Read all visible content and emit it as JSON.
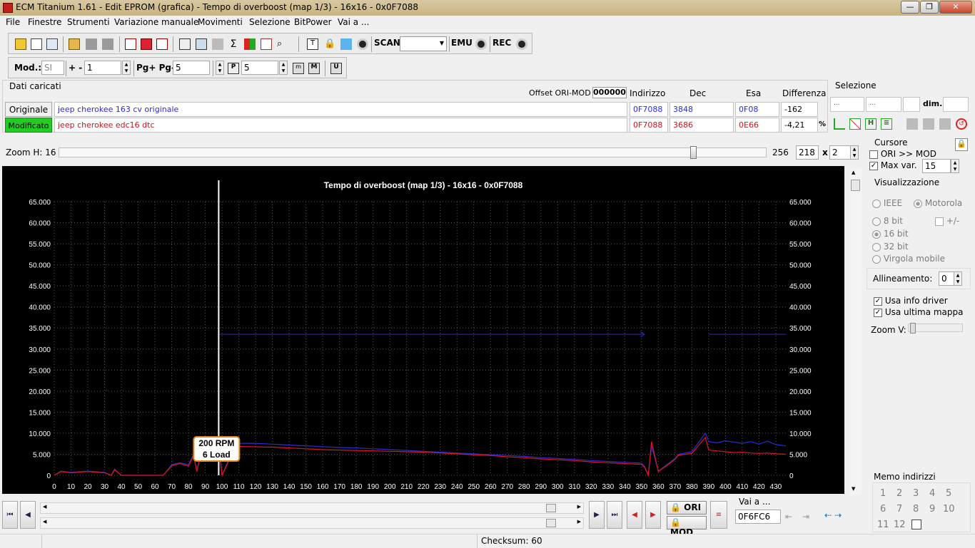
{
  "window": {
    "title": "ECM Titanium 1.61 - Edit EPROM (grafica) - Tempo di overboost (map 1/3) - 16x16 - 0x0F7088"
  },
  "menu": [
    "File",
    "Finestre",
    "Strumenti",
    "Variazione manuale",
    "Movimenti",
    "Selezione",
    "BitPower",
    "Vai a ..."
  ],
  "toolbar": {
    "scan_label": "SCAN",
    "emu_label": "EMU",
    "rec_label": "REC"
  },
  "toolbar2": {
    "mod_label": "Mod.:",
    "mod_value": "SI",
    "plusminus_label": "+ -",
    "plusminus_value": "1",
    "pg_label": "Pg+ Pg-",
    "pg_value": "5",
    "p_value": "5"
  },
  "dati": {
    "header": "Dati caricati",
    "offset_label": "Offset ORI-MOD",
    "offset_value": "000000",
    "col_indirizzo": "Indirizzo",
    "col_dec": "Dec",
    "col_esa": "Esa",
    "col_diff": "Differenza",
    "originale_label": "Originale",
    "originale_name": "jeep cherokee 163 cv originale",
    "originale_addr": "0F7088",
    "originale_dec": "3848",
    "originale_esa": "0F08",
    "originale_diff": "-162",
    "modificato_label": "Modificato",
    "modificato_name": "jeep cherokee edc16 dtc",
    "modificato_addr": "0F7088",
    "modificato_dec": "3686",
    "modificato_esa": "0E66",
    "modificato_diff": "-4,21",
    "percent": "%"
  },
  "selezione": {
    "label": "Selezione",
    "f1": "...",
    "f2": "...",
    "dim_label": "dim."
  },
  "zoom": {
    "label": "Zoom H: 16",
    "max": "256",
    "w": "218",
    "x_label": "x",
    "h": "2",
    "level": 0.9
  },
  "cursore": {
    "label": "Cursore",
    "ori_mod": "ORI >> MOD",
    "max_var_label": "Max var.",
    "max_var_value": "15"
  },
  "visual": {
    "label": "Visualizzazione",
    "ieee": "IEEE",
    "motorola": "Motorola",
    "b8": "8 bit",
    "pm": "+/-",
    "b16": "16 bit",
    "b32": "32 bit",
    "virgola": "Virgola mobile",
    "allineamento_label": "Allineamento:",
    "allineamento_value": "0",
    "usa_info": "Usa info driver",
    "usa_ultima": "Usa ultima mappa",
    "zoomv_label": "Zoom V:"
  },
  "memo": {
    "label": "Memo indirizzi",
    "slots": [
      "1",
      "2",
      "3",
      "4",
      "5",
      "6",
      "7",
      "8",
      "9",
      "10",
      "11",
      "12"
    ]
  },
  "bottom": {
    "vai_a_label": "Vai a ...",
    "vai_a_value": "0F6FC6",
    "ori_btn": "ORI",
    "mod_btn": "MOD"
  },
  "status": {
    "checksum": "Checksum: 60"
  },
  "colors": {
    "ori": "#2b2bd6",
    "mod": "#e0141e",
    "chart_bg": "#000000",
    "modificato_bg": "#22cc22"
  },
  "chart_data": {
    "type": "line",
    "title": "Tempo di overboost (map 1/3) - 16x16 - 0x0F7088",
    "xlabel": "",
    "ylabel": "",
    "xlim": [
      0,
      436
    ],
    "ylim": [
      0,
      65000
    ],
    "x_ticks": [
      0,
      10,
      20,
      30,
      40,
      50,
      60,
      70,
      80,
      90,
      100,
      110,
      120,
      130,
      140,
      150,
      160,
      170,
      180,
      190,
      200,
      210,
      220,
      230,
      240,
      250,
      260,
      270,
      280,
      290,
      300,
      310,
      320,
      330,
      340,
      350,
      360,
      370,
      380,
      390,
      400,
      410,
      420,
      430
    ],
    "y_ticks": [
      "0",
      "5.000",
      "10.000",
      "15.000",
      "20.000",
      "25.000",
      "30.000",
      "35.000",
      "40.000",
      "45.000",
      "50.000",
      "55.000",
      "60.000",
      "65.000"
    ],
    "y_tick_values": [
      0,
      5000,
      10000,
      15000,
      20000,
      25000,
      30000,
      35000,
      40000,
      45000,
      50000,
      55000,
      60000,
      65000
    ],
    "grid": true,
    "cursor_x": 98,
    "cursor_label": [
      "200 RPM",
      "6 Load"
    ],
    "series": [
      {
        "name": "ORI",
        "color": "#2b2bd6",
        "x": [
          0,
          4,
          10,
          20,
          30,
          34,
          36,
          40,
          50,
          60,
          65,
          70,
          75,
          80,
          83,
          85,
          88,
          92,
          98,
          100,
          108,
          115,
          120,
          125,
          130,
          135,
          140,
          145,
          150,
          155,
          160,
          170,
          180,
          190,
          200,
          210,
          220,
          230,
          240,
          250,
          260,
          270,
          280,
          290,
          300,
          310,
          320,
          330,
          340,
          350,
          352,
          354,
          356,
          360,
          365,
          370,
          372,
          380,
          388,
          390,
          395,
          400,
          405,
          410,
          415,
          420,
          425,
          430,
          436
        ],
        "y": [
          0,
          1000,
          700,
          1000,
          700,
          0,
          1500,
          0,
          0,
          0,
          0,
          2500,
          3000,
          2500,
          5000,
          1000,
          7000,
          7600,
          7200,
          0,
          7600,
          7600,
          7600,
          7500,
          7400,
          7300,
          7200,
          7100,
          7000,
          6900,
          6800,
          6600,
          6500,
          6300,
          6100,
          5900,
          5700,
          5500,
          5300,
          5100,
          4900,
          4700,
          4500,
          4200,
          4000,
          3800,
          3500,
          3300,
          3100,
          2900,
          2000,
          0,
          7000,
          1000,
          2500,
          4000,
          5000,
          5600,
          10000,
          8000,
          7700,
          8200,
          7900,
          7600,
          8000,
          7400,
          8100,
          7300,
          7000
        ]
      },
      {
        "name": "MOD",
        "color": "#e0141e",
        "x": [
          0,
          4,
          10,
          20,
          30,
          34,
          36,
          40,
          50,
          60,
          65,
          70,
          75,
          80,
          83,
          85,
          88,
          92,
          98,
          100,
          108,
          115,
          120,
          125,
          130,
          135,
          140,
          145,
          150,
          155,
          160,
          170,
          180,
          190,
          200,
          210,
          220,
          230,
          240,
          250,
          260,
          270,
          280,
          290,
          300,
          310,
          320,
          330,
          340,
          350,
          352,
          354,
          356,
          360,
          365,
          370,
          372,
          380,
          388,
          390,
          395,
          400,
          405,
          410,
          415,
          420,
          425,
          430,
          436
        ],
        "y": [
          0,
          900,
          600,
          900,
          600,
          0,
          1300,
          0,
          0,
          0,
          0,
          2300,
          2800,
          2200,
          4700,
          900,
          6600,
          7100,
          6900,
          0,
          6900,
          6800,
          6800,
          6700,
          6700,
          6600,
          6500,
          6400,
          6300,
          6200,
          6100,
          6000,
          5900,
          5800,
          5700,
          5600,
          5500,
          5300,
          5100,
          4900,
          4700,
          4400,
          4200,
          3900,
          3700,
          3500,
          3200,
          3000,
          2800,
          2600,
          1800,
          0,
          8000,
          900,
          2300,
          3800,
          4800,
          5200,
          9000,
          6000,
          5800,
          5600,
          5400,
          5500,
          5300,
          5200,
          5300,
          5100,
          5000
        ]
      },
      {
        "name": "",
        "color": "#2b2bd6",
        "x": [
          98,
          355,
          390,
          436
        ],
        "y": [
          33500,
          33500,
          33500,
          33500
        ],
        "gaps": [
          [
            355,
            390
          ]
        ]
      }
    ]
  }
}
